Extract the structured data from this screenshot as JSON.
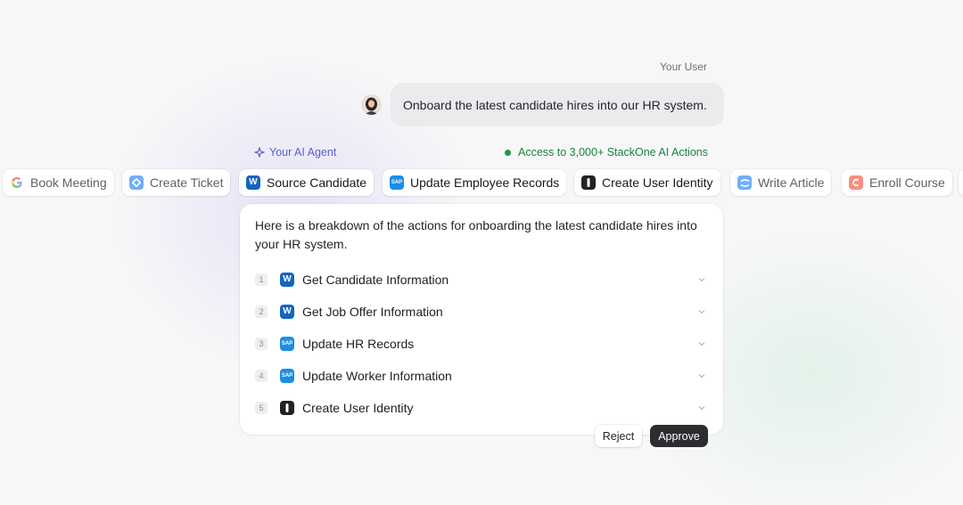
{
  "colors": {
    "accent_agent": "#5b5fc7",
    "accent_access": "#17843f",
    "workday_blue": "#1565c0",
    "sap_blue": "#1a8ee6",
    "okta_dark": "#202225",
    "approve_bg": "#2b2d31"
  },
  "conversation": {
    "user_label": "Your User",
    "user_message": "Onboard the latest candidate hires into our HR system.",
    "agent_label": "Your AI Agent",
    "access_label": "Access to 3,000+ StackOne AI Actions"
  },
  "action_chips": [
    {
      "label": "Book Meeting",
      "icon": "google-icon",
      "state": "dim"
    },
    {
      "label": "Create Ticket",
      "icon": "jira-icon",
      "state": "dim"
    },
    {
      "label": "Source Candidate",
      "icon": "workday-icon",
      "state": "active"
    },
    {
      "label": "Update Employee Records",
      "icon": "sap-icon",
      "state": "active"
    },
    {
      "label": "Create User Identity",
      "icon": "okta-icon",
      "state": "active"
    },
    {
      "label": "Write Article",
      "icon": "confluence-icon",
      "state": "dim"
    },
    {
      "label": "Enroll Course",
      "icon": "course-icon",
      "state": "dim"
    }
  ],
  "response": {
    "intro": "Here is a breakdown of the actions for onboarding the latest candidate hires into your HR system.",
    "steps": [
      {
        "number": "1",
        "label": "Get Candidate Information",
        "icon": "workday-icon"
      },
      {
        "number": "2",
        "label": "Get Job Offer Information",
        "icon": "workday-icon"
      },
      {
        "number": "3",
        "label": "Update HR Records",
        "icon": "sap-icon"
      },
      {
        "number": "4",
        "label": "Update Worker Information",
        "icon": "sap-icon"
      },
      {
        "number": "5",
        "label": "Create User Identity",
        "icon": "okta-icon"
      }
    ],
    "reject_label": "Reject",
    "approve_label": "Approve"
  }
}
